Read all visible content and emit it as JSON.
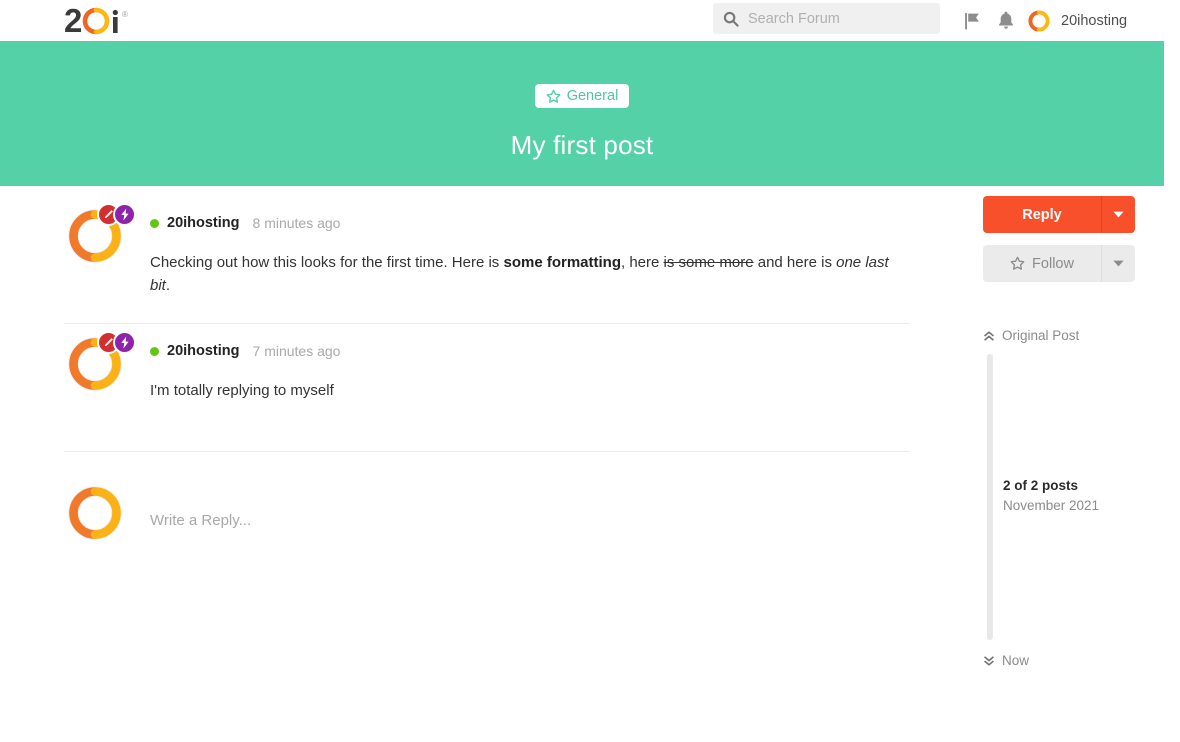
{
  "brand": {
    "logo_text": "20i",
    "logo_trademark": "®",
    "accent_orange": "#f47b20",
    "accent_yellow": "#fcb813",
    "accent_red_orange": "#f8502a",
    "banner_green": "#54d1a6"
  },
  "topbar": {
    "logo_name": "20i-logo",
    "search": {
      "placeholder": "Search Forum",
      "value": "",
      "icon": "search-icon"
    },
    "icons": [
      {
        "name": "flag-icon",
        "label": "Flag"
      },
      {
        "name": "bell-icon",
        "label": "Notifications"
      }
    ],
    "user": {
      "name": "20ihosting",
      "avatar": "user-avatar-ring"
    }
  },
  "banner": {
    "category_badge": {
      "icon": "star-outline-icon",
      "label": "General"
    },
    "title": "My first post"
  },
  "posts": [
    {
      "author": "20ihosting",
      "status": "online",
      "time": "8 minutes ago",
      "badges": [
        {
          "name": "badge-edit-icon",
          "color": "#d32f2f"
        },
        {
          "name": "badge-bolt-icon",
          "color": "#8e24aa"
        }
      ],
      "body": {
        "part1": "Checking out how this looks for the first time. Here is ",
        "bold": "some formatting",
        "part2": ", here ",
        "strike": "is some more",
        "part3": " and here is ",
        "italic": "one last bit",
        "part4": "."
      }
    },
    {
      "author": "20ihosting",
      "status": "online",
      "time": "7 minutes ago",
      "badges": [
        {
          "name": "badge-edit-icon",
          "color": "#d32f2f"
        },
        {
          "name": "badge-bolt-icon",
          "color": "#8e24aa"
        }
      ],
      "body": {
        "plain": "I'm totally replying to myself"
      }
    }
  ],
  "composer": {
    "placeholder": "Write a Reply...",
    "avatar": "composer-avatar-ring"
  },
  "sidebar": {
    "reply_button": {
      "label": "Reply",
      "caret": "chevron-down-icon"
    },
    "follow_button": {
      "label": "Follow",
      "icon": "star-outline-icon",
      "caret": "chevron-down-icon"
    },
    "timeline": {
      "top_label": "Original Post",
      "top_icon": "double-chevron-up-icon",
      "bottom_label": "Now",
      "bottom_icon": "double-chevron-down-icon",
      "count": "2 of 2 posts",
      "date": "November 2021"
    }
  }
}
